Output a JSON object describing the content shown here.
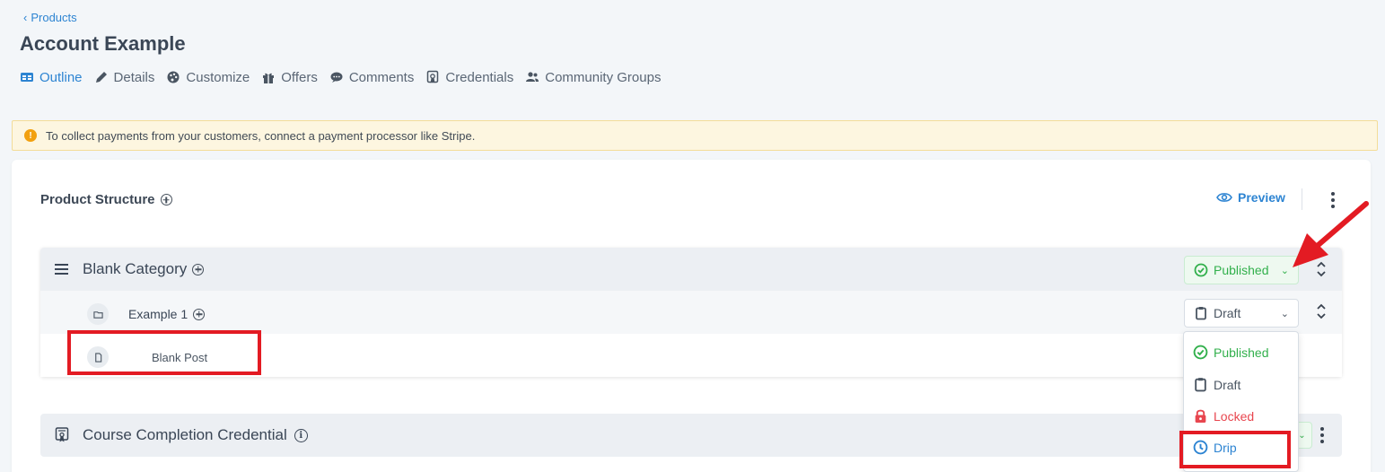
{
  "nav": {
    "back_label": "Products"
  },
  "page": {
    "title": "Account Example"
  },
  "tabs": [
    {
      "label": "Outline",
      "icon": "outline-icon"
    },
    {
      "label": "Details",
      "icon": "pencil-icon"
    },
    {
      "label": "Customize",
      "icon": "palette-icon"
    },
    {
      "label": "Offers",
      "icon": "gift-icon"
    },
    {
      "label": "Comments",
      "icon": "comment-icon"
    },
    {
      "label": "Credentials",
      "icon": "certificate-icon"
    },
    {
      "label": "Community Groups",
      "icon": "users-icon"
    }
  ],
  "alert": {
    "text": "To collect payments from your customers, connect a payment processor like Stripe.",
    "icon": "alert-icon"
  },
  "structure": {
    "title": "Product Structure",
    "preview_label": "Preview",
    "category": {
      "label": "Blank Category",
      "status": "Published"
    },
    "subcategory": {
      "label": "Example 1",
      "status": "Draft"
    },
    "post": {
      "label": "Blank Post"
    },
    "credential": {
      "label": "Course Completion Credential"
    }
  },
  "status_menu": {
    "options": [
      {
        "label": "Published",
        "icon": "check-circle-icon"
      },
      {
        "label": "Draft",
        "icon": "clipboard-icon"
      },
      {
        "label": "Locked",
        "icon": "lock-icon"
      },
      {
        "label": "Drip",
        "icon": "clock-icon"
      }
    ]
  },
  "colors": {
    "accent": "#2d84d2",
    "published": "#32b04c",
    "locked": "#e8464f",
    "annotation": "#e31b23",
    "alert_bg": "#fdf6e0"
  }
}
